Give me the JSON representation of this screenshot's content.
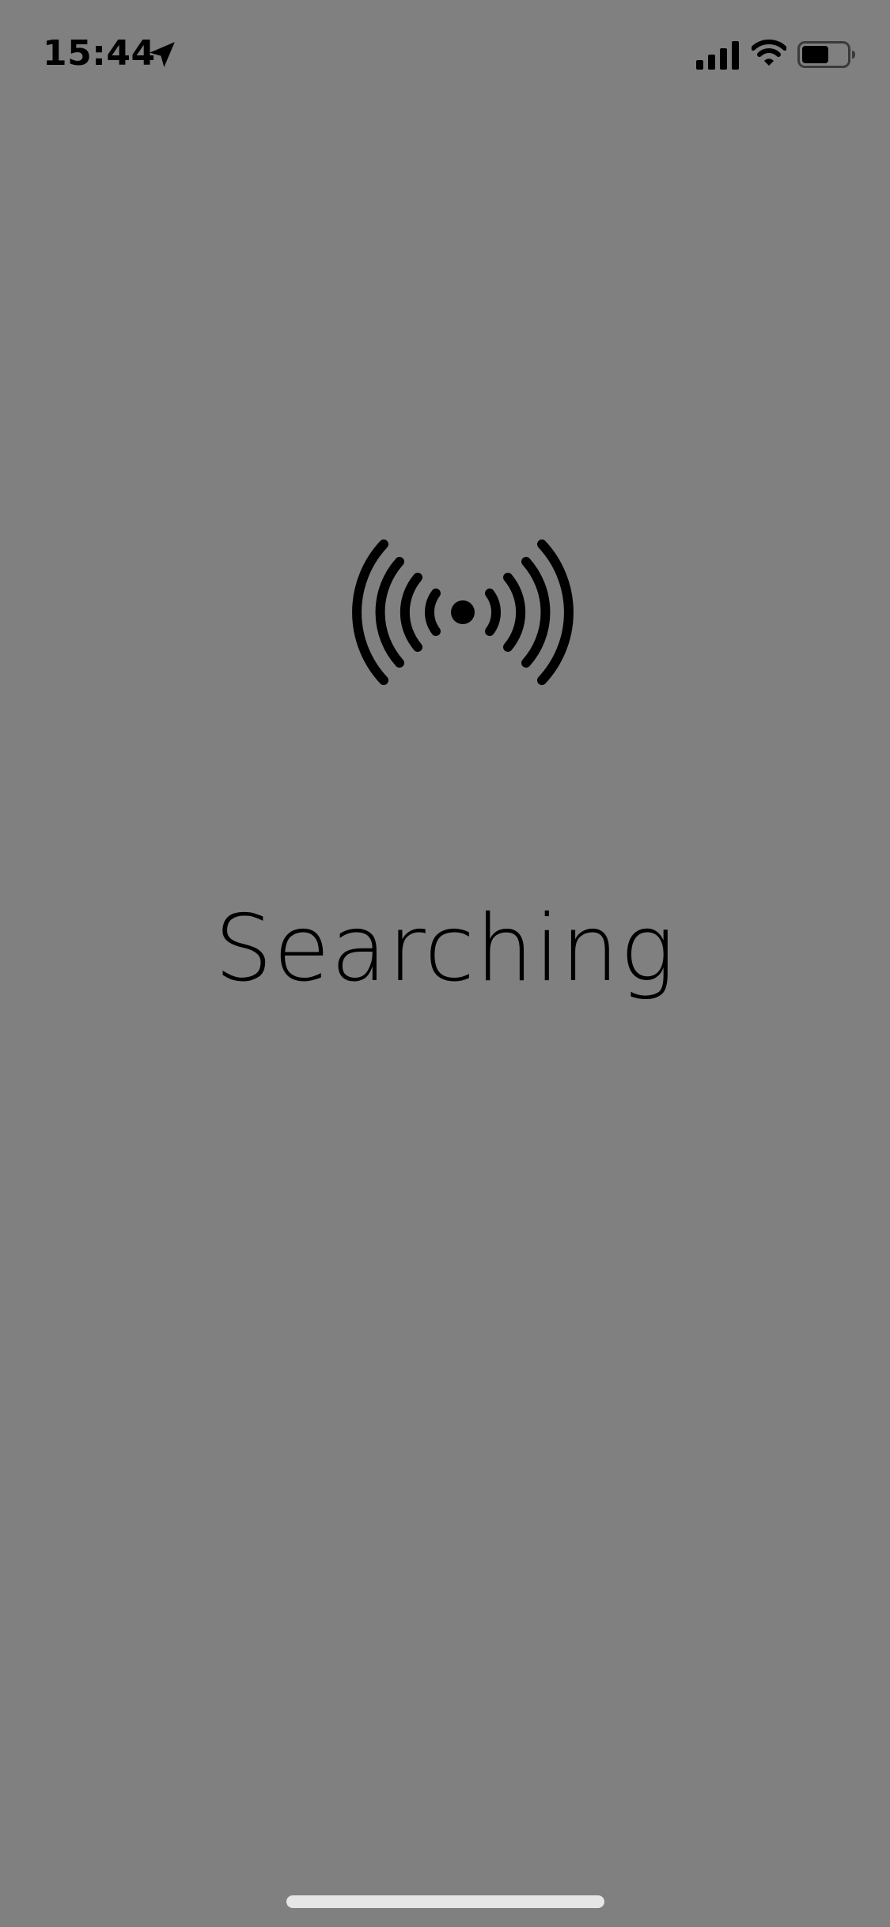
{
  "status_bar": {
    "time": "15:44",
    "location_icon": "location-arrow-icon",
    "signal_icon": "cellular-signal-icon",
    "wifi_icon": "wifi-icon",
    "battery_icon": "battery-icon",
    "battery_level_fraction": 0.6
  },
  "main": {
    "icon": "broadcast-signal-icon",
    "status_text": "Searching"
  },
  "colors": {
    "background": "#808080",
    "foreground": "#000000",
    "home_indicator": "#e6e6e6"
  }
}
